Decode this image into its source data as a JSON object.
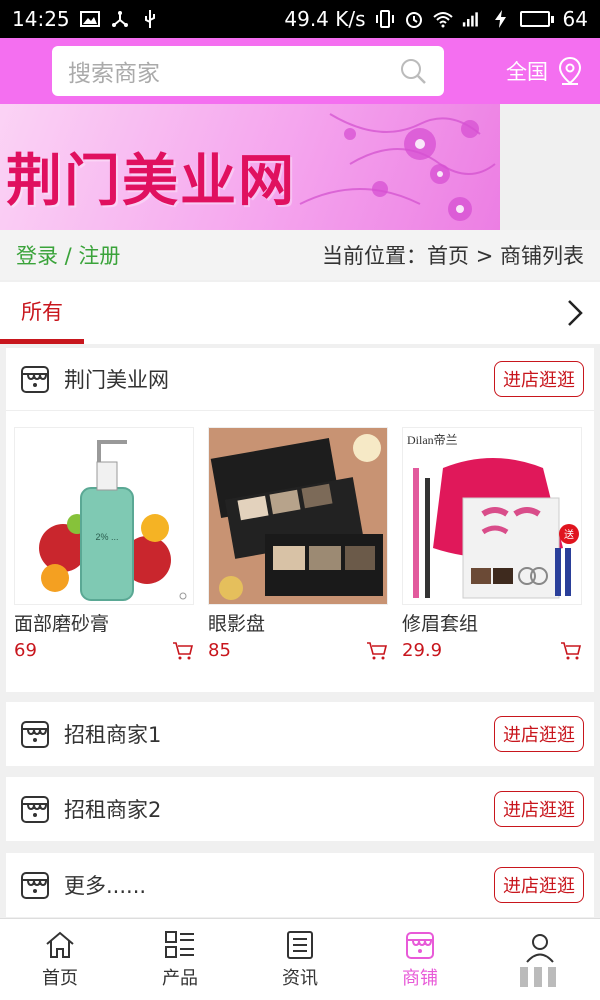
{
  "status_bar": {
    "time": "14:25",
    "speed": "49.4 K/s",
    "battery_level": "64"
  },
  "header": {
    "search_placeholder": "搜索商家",
    "region_label": "全国"
  },
  "banner": {
    "brand_text": "荆门美业网"
  },
  "location": {
    "login_register": "登录 / 注册",
    "breadcrumb": "当前位置：首页 > 商铺列表"
  },
  "tabs": {
    "all_label": "所有"
  },
  "shops": [
    {
      "name": "荆门美业网",
      "button": "进店逛逛",
      "products": [
        {
          "name": "面部磨砂膏",
          "price": "69"
        },
        {
          "name": "眼影盘",
          "price": "85"
        },
        {
          "name": "修眉套组",
          "price": "29.9",
          "brand_label": "Dilan帝兰",
          "badge": "送"
        }
      ]
    },
    {
      "name": "招租商家1",
      "button": "进店逛逛"
    },
    {
      "name": "招租商家2",
      "button": "进店逛逛"
    },
    {
      "name": "更多......",
      "button": "进店逛逛"
    }
  ],
  "bottom_nav": [
    {
      "label": "首页",
      "icon": "home-icon"
    },
    {
      "label": "产品",
      "icon": "product-list-icon"
    },
    {
      "label": "资讯",
      "icon": "news-icon"
    },
    {
      "label": "商铺",
      "icon": "store-icon",
      "active": true
    },
    {
      "label": "",
      "icon": "user-icon"
    }
  ],
  "colors": {
    "accent_pink": "#f46ff0",
    "brand_red": "#c8161d",
    "login_green": "#3aa33a"
  }
}
